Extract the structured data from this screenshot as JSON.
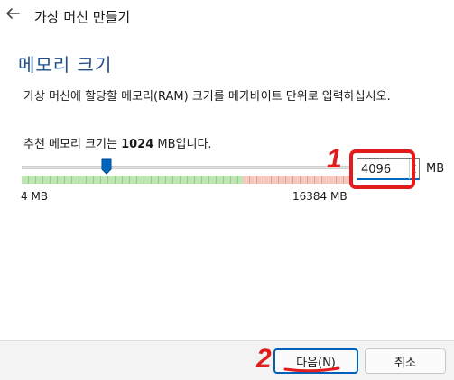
{
  "header": {
    "title": "가상 머신 만들기",
    "back_icon": "back-arrow-icon"
  },
  "page": {
    "title": "메모리 크기",
    "description": "가상 머신에 할당할 메모리(RAM) 크기를 메가바이트 단위로 입력하십시오.",
    "recommend_prefix": "추천 메모리 크기는 ",
    "recommend_value": "1024",
    "recommend_suffix": " MB입니다."
  },
  "memory": {
    "value": "4096",
    "unit": "MB",
    "min_label": "4 MB",
    "max_label": "16384 MB",
    "min_mb": 4,
    "max_mb": 16384,
    "recommended_mb": 1024,
    "safe_limit_fraction": 0.67
  },
  "buttons": {
    "next": "다음(N)",
    "cancel": "취소"
  },
  "annotations": {
    "mark_1": "1",
    "mark_2": "2",
    "color": "#e11c1c"
  },
  "colors": {
    "accent": "#1f4e8a",
    "focus": "#0067c0",
    "primary_border": "#005fb8"
  }
}
